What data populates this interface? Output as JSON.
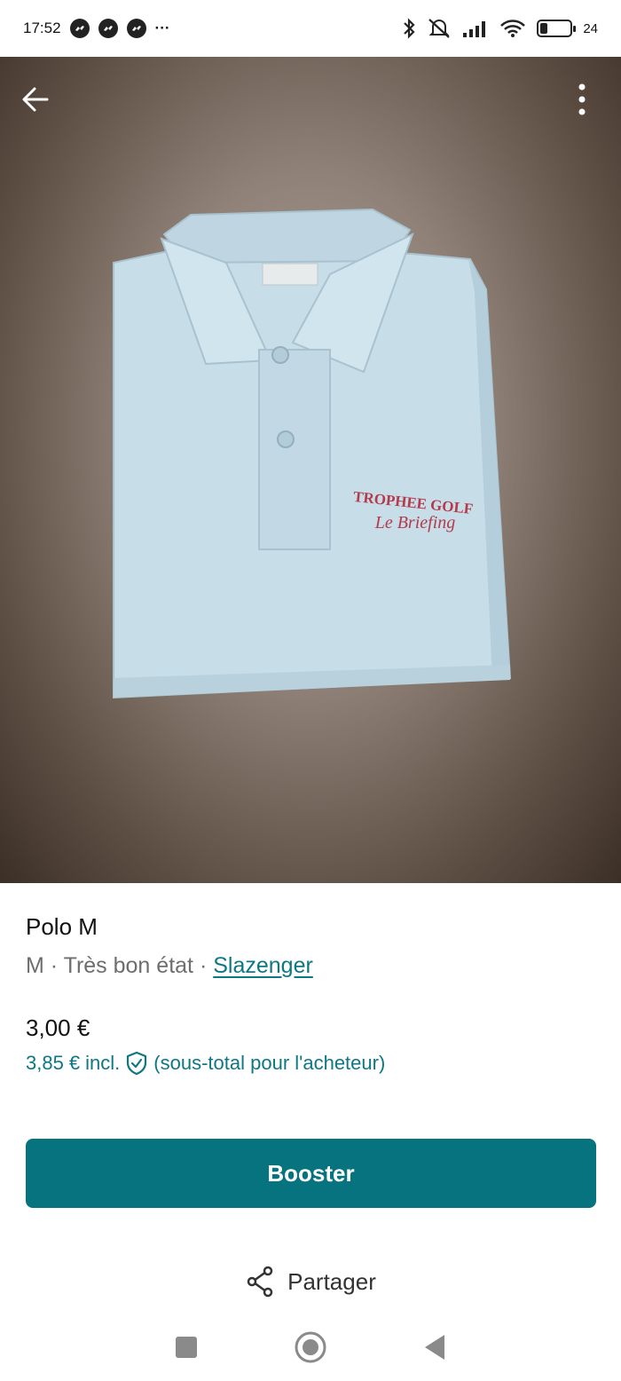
{
  "status_bar": {
    "time": "17:52",
    "more": "···",
    "battery_text": "24",
    "battery_level": 0.24,
    "icons": [
      "messenger-icon",
      "messenger-icon",
      "messenger-icon",
      "bluetooth-icon",
      "mute-icon",
      "signal-icon",
      "wifi-icon",
      "battery-icon"
    ]
  },
  "photo": {
    "embroidery_line1": "TROPHEE GOLF",
    "embroidery_line2": "Le Briefing",
    "background_color": "#6b5b4f",
    "shirt_color": "#c7dde8"
  },
  "item": {
    "title": "Polo M",
    "size": "M",
    "separator": "·",
    "condition": "Très bon état",
    "brand": "Slazenger",
    "price": "3,00 €",
    "buyer_price": "3,85 €",
    "buyer_incl": "incl.",
    "buyer_note": "(sous-total pour l'acheteur)"
  },
  "actions": {
    "booster_label": "Booster",
    "share_label": "Partager"
  },
  "colors": {
    "accent": "#07737f",
    "link": "#0e7784"
  }
}
